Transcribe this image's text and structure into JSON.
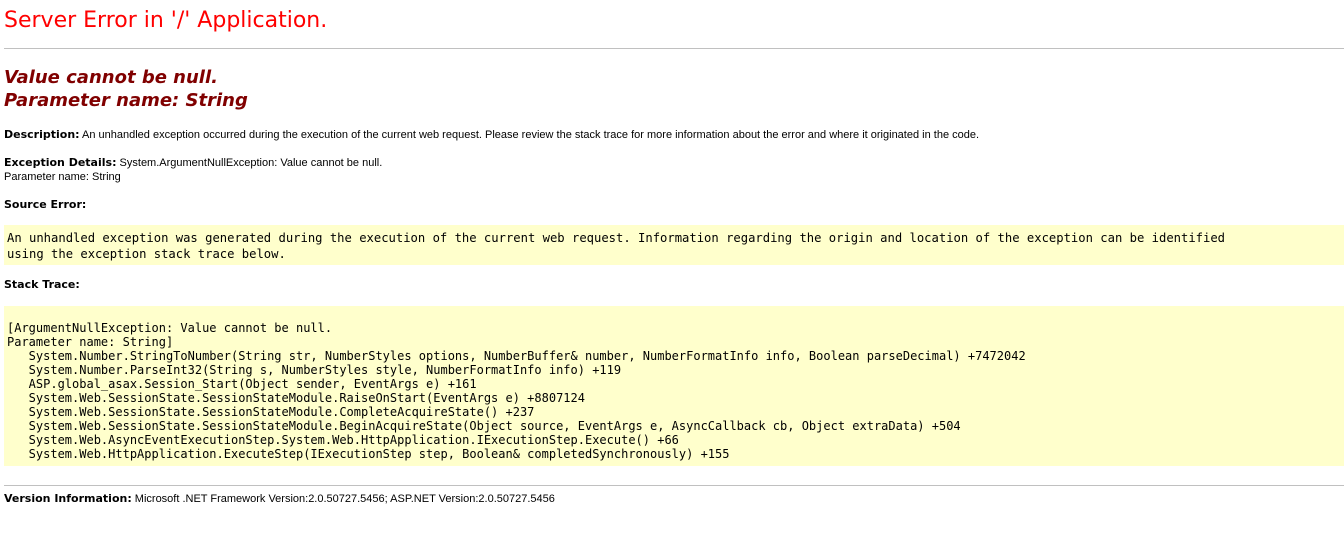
{
  "page": {
    "title": "Server Error in '/' Application.",
    "error_message": [
      "Value cannot be null.",
      "Parameter name: String"
    ]
  },
  "description": {
    "label": "Description:",
    "text": "An unhandled exception occurred during the execution of the current web request. Please review the stack trace for more information about the error and where it originated in the code."
  },
  "exception_details": {
    "label": "Exception Details:",
    "text": "System.ArgumentNullException: Value cannot be null.",
    "text2": "Parameter name: String"
  },
  "source_error": {
    "label": "Source Error:",
    "lines": [
      "An unhandled exception was generated during the execution of the current web request. Information regarding the origin and location of the exception can be identified",
      "using the exception stack trace below."
    ]
  },
  "stack_trace": {
    "label": "Stack Trace:",
    "lines": [
      "[ArgumentNullException: Value cannot be null.",
      "Parameter name: String]",
      "   System.Number.StringToNumber(String str, NumberStyles options, NumberBuffer& number, NumberFormatInfo info, Boolean parseDecimal) +7472042",
      "   System.Number.ParseInt32(String s, NumberStyles style, NumberFormatInfo info) +119",
      "   ASP.global_asax.Session_Start(Object sender, EventArgs e) +161",
      "   System.Web.SessionState.SessionStateModule.RaiseOnStart(EventArgs e) +8807124",
      "   System.Web.SessionState.SessionStateModule.CompleteAcquireState() +237",
      "   System.Web.SessionState.SessionStateModule.BeginAcquireState(Object source, EventArgs e, AsyncCallback cb, Object extraData) +504",
      "   System.Web.AsyncEventExecutionStep.System.Web.HttpApplication.IExecutionStep.Execute() +66",
      "   System.Web.HttpApplication.ExecuteStep(IExecutionStep step, Boolean& completedSynchronously) +155"
    ]
  },
  "version_info": {
    "label": "Version Information:",
    "text": "Microsoft .NET Framework Version:2.0.50727.5456; ASP.NET Version:2.0.50727.5456"
  },
  "colors": {
    "title": "#ff0000",
    "error_message": "#800000",
    "code_background": "#ffffcc",
    "rule": "#c0c0c0"
  }
}
